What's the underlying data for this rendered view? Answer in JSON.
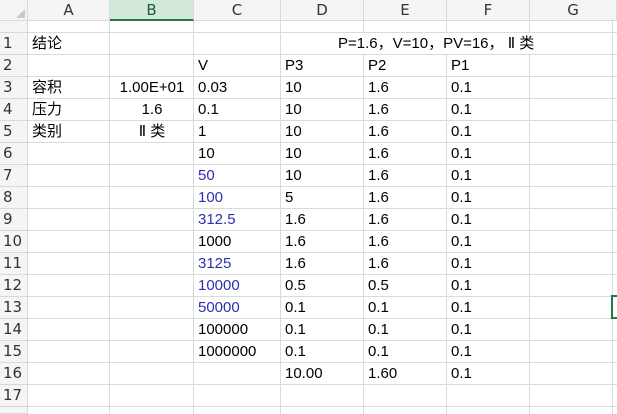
{
  "columns": [
    "A",
    "B",
    "C",
    "D",
    "E",
    "F",
    "G"
  ],
  "rows": [
    "1",
    "2",
    "3",
    "4",
    "5",
    "6",
    "7",
    "8",
    "9",
    "10",
    "11",
    "12",
    "13",
    "14",
    "15",
    "16",
    "17"
  ],
  "selected_column": "B",
  "selected_row": "13",
  "r1": {
    "a": "结论",
    "d": "P=1.6，V=10，PV=16， Ⅱ 类"
  },
  "r2": {
    "c": "V",
    "d": "P3",
    "e": "P2",
    "f": "P1"
  },
  "r3": {
    "a": "容积",
    "b": "1.00E+01",
    "c": "0.03",
    "d": "10",
    "e": "1.6",
    "f": "0.1"
  },
  "r4": {
    "a": "压力",
    "b": "1.6",
    "c": "0.1",
    "d": "10",
    "e": "1.6",
    "f": "0.1"
  },
  "r5": {
    "a": "类别",
    "b": "Ⅱ 类",
    "c": "1",
    "d": "10",
    "e": "1.6",
    "f": "0.1"
  },
  "r6": {
    "c": "10",
    "d": "10",
    "e": "1.6",
    "f": "0.1"
  },
  "r7": {
    "c": "50",
    "d": "10",
    "e": "1.6",
    "f": "0.1"
  },
  "r8": {
    "c": "100",
    "d": "5",
    "e": "1.6",
    "f": "0.1"
  },
  "r9": {
    "c": "312.5",
    "d": "1.6",
    "e": "1.6",
    "f": "0.1"
  },
  "r10": {
    "c": "1000",
    "d": "1.6",
    "e": "1.6",
    "f": "0.1"
  },
  "r11": {
    "c": "3125",
    "d": "1.6",
    "e": "1.6",
    "f": "0.1"
  },
  "r12": {
    "c": "10000",
    "d": "0.5",
    "e": "0.5",
    "f": "0.1"
  },
  "r13": {
    "c": "50000",
    "d": "0.1",
    "e": "0.1",
    "f": "0.1"
  },
  "r14": {
    "c": "100000",
    "d": "0.1",
    "e": "0.1",
    "f": "0.1"
  },
  "r15": {
    "c": "1000000",
    "d": "0.1",
    "e": "0.1",
    "f": "0.1"
  },
  "r16": {
    "d": "10.00",
    "e": "1.60",
    "f": "0.1"
  },
  "colors": {
    "blue_text": "#2f2fb3",
    "selection": "#1f7a45",
    "header_bg": "#f5f5f5"
  }
}
